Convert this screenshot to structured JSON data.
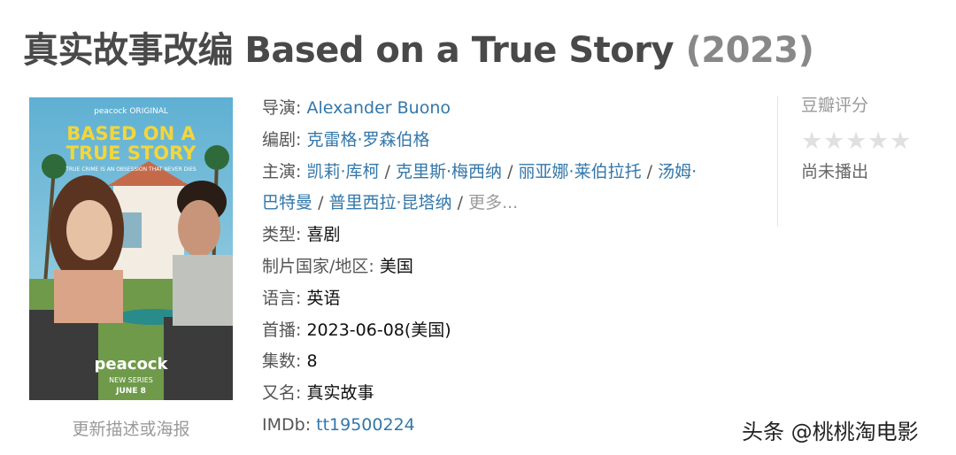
{
  "header": {
    "title": "真实故事改编 Based on a True Story",
    "year": "(2023)"
  },
  "poster": {
    "brand_top": "peacock ORIGINAL",
    "title_line1": "BASED ON A",
    "title_line2": "TRUE STORY",
    "tagline": "TRUE CRIME IS AN OBSESSION THAT NEVER DIES",
    "brand_bottom": "peacock",
    "series_line1": "NEW SERIES",
    "series_line2": "JUNE 8",
    "update_link": "更新描述或海报"
  },
  "info": {
    "director_label": "导演:",
    "director": "Alexander Buono",
    "writer_label": "编剧:",
    "writer": "克雷格·罗森伯格",
    "cast_label": "主演:",
    "cast": [
      "凯莉·库柯",
      "克里斯·梅西纳",
      "丽亚娜·莱伯拉托",
      "汤姆·",
      "巴特曼",
      "普里西拉·昆塔纳"
    ],
    "cast_sep": "/",
    "more": "更多...",
    "genre_label": "类型:",
    "genre": "喜剧",
    "country_label": "制片国家/地区:",
    "country": "美国",
    "language_label": "语言:",
    "language": "英语",
    "premiere_label": "首播:",
    "premiere": "2023-06-08(美国)",
    "episodes_label": "集数:",
    "episodes": "8",
    "aka_label": "又名:",
    "aka": "真实故事",
    "imdb_label": "IMDb:",
    "imdb": "tt19500224"
  },
  "rating": {
    "label": "豆瓣评分",
    "stars": 0,
    "status": "尚未播出"
  },
  "watermark": "头条 @桃桃淘电影"
}
